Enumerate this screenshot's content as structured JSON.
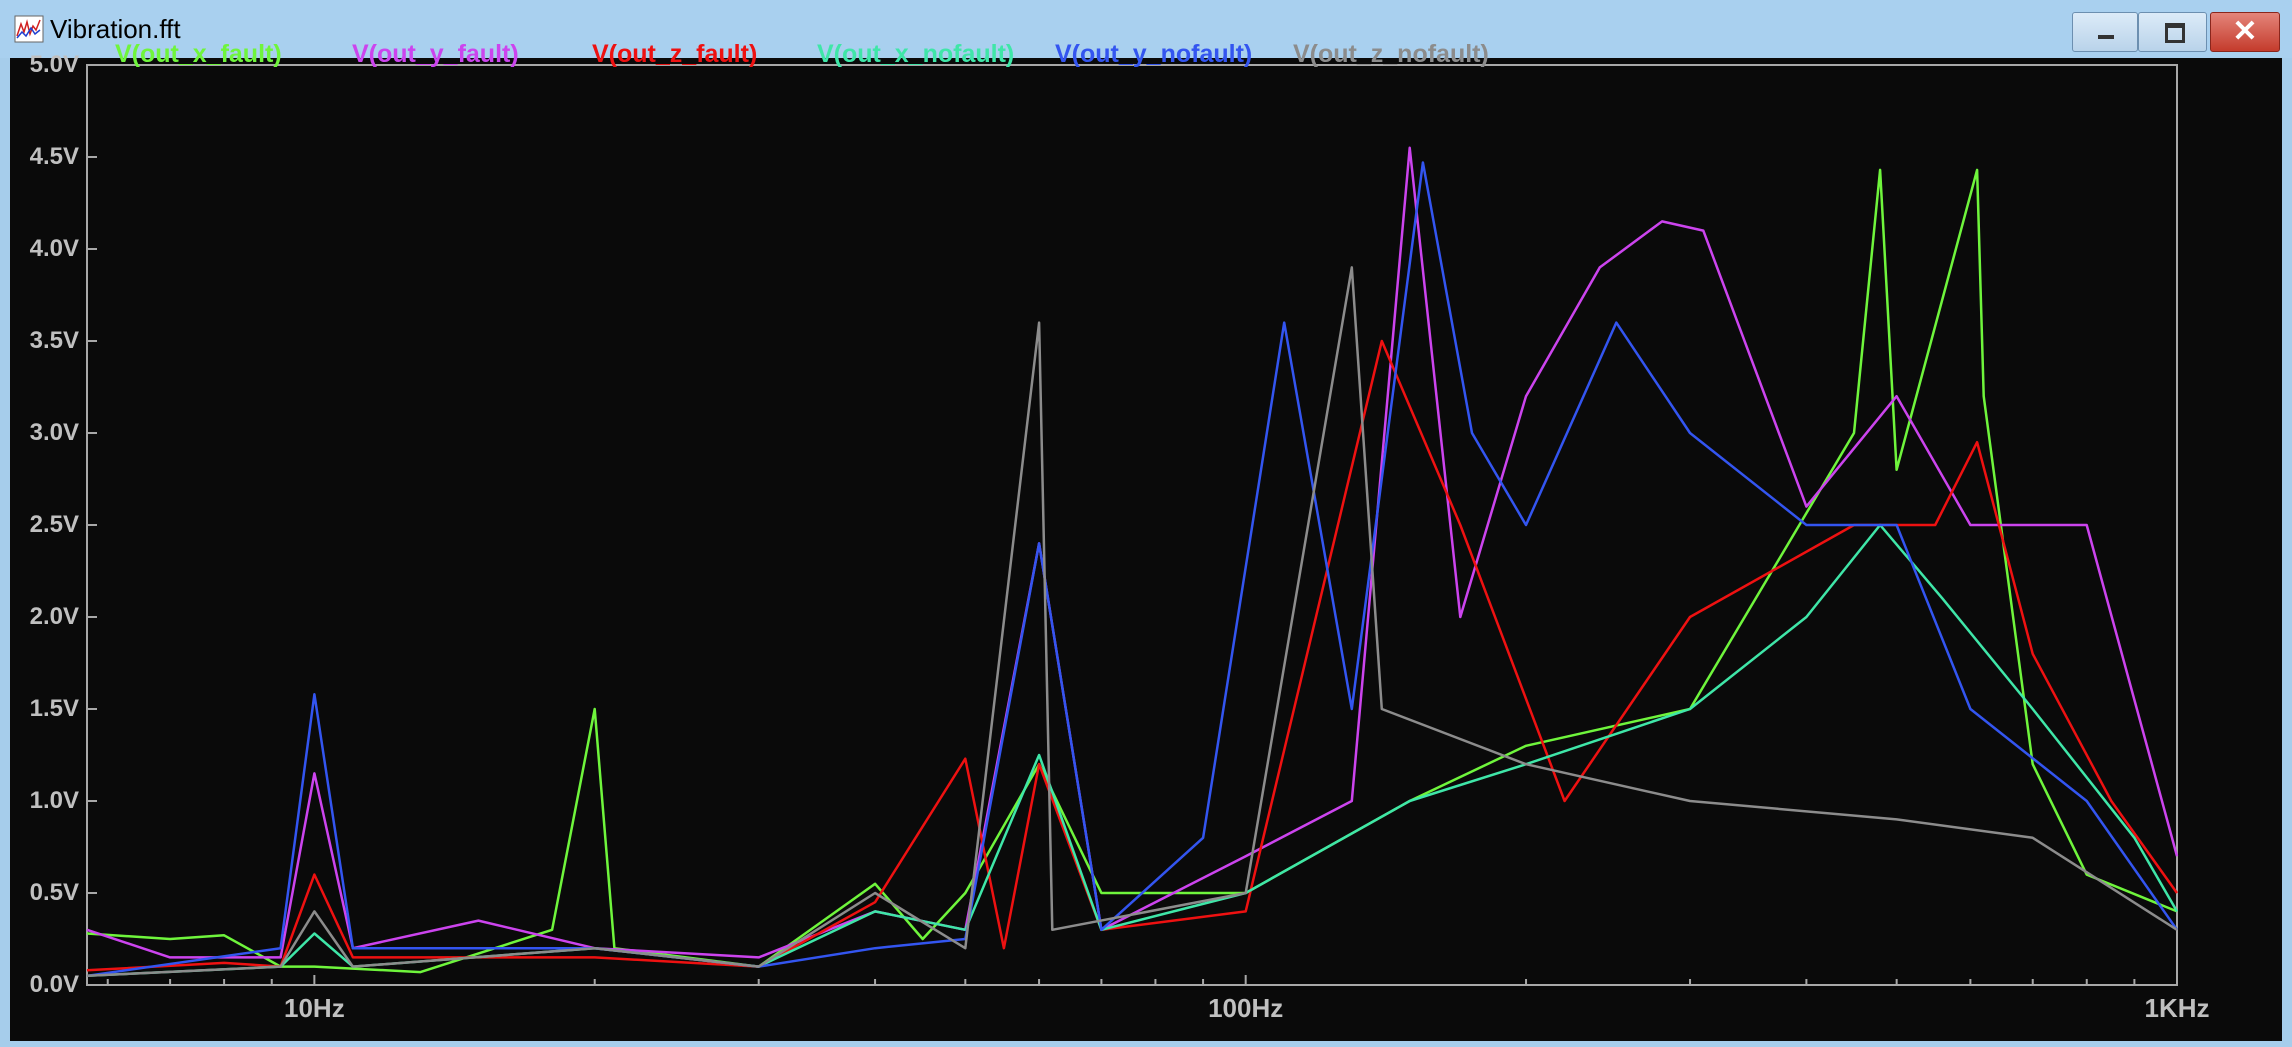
{
  "window": {
    "title": "Vibration.fft",
    "controls": {
      "minimize": "minimize-icon",
      "maximize": "maximize-icon",
      "close": "close-icon"
    }
  },
  "chart_data": {
    "type": "line",
    "title": "",
    "xlabel": "",
    "ylabel": "",
    "x_scale": "log",
    "xlim": [
      5.7,
      1000
    ],
    "ylim": [
      0,
      5.0
    ],
    "x_ticks": [
      {
        "value": 10,
        "label": "10Hz"
      },
      {
        "value": 100,
        "label": "100Hz"
      },
      {
        "value": 1000,
        "label": "1KHz"
      }
    ],
    "y_ticks": [
      {
        "value": 0.0,
        "label": "0.0V"
      },
      {
        "value": 0.5,
        "label": "0.5V"
      },
      {
        "value": 1.0,
        "label": "1.0V"
      },
      {
        "value": 1.5,
        "label": "1.5V"
      },
      {
        "value": 2.0,
        "label": "2.0V"
      },
      {
        "value": 2.5,
        "label": "2.5V"
      },
      {
        "value": 3.0,
        "label": "3.0V"
      },
      {
        "value": 3.5,
        "label": "3.5V"
      },
      {
        "value": 4.0,
        "label": "4.0V"
      },
      {
        "value": 4.5,
        "label": "4.5V"
      },
      {
        "value": 5.0,
        "label": "5.0V"
      }
    ],
    "legend": "top",
    "background": "#0a0a0a",
    "grid": false,
    "series": [
      {
        "name": "V(out_x_fault)",
        "color": "#6ff53c",
        "points": [
          [
            5.7,
            0.28
          ],
          [
            7,
            0.25
          ],
          [
            8,
            0.27
          ],
          [
            9.2,
            0.1
          ],
          [
            10,
            0.1
          ],
          [
            13,
            0.07
          ],
          [
            18,
            0.3
          ],
          [
            20,
            1.5
          ],
          [
            21,
            0.2
          ],
          [
            30,
            0.1
          ],
          [
            40,
            0.55
          ],
          [
            45,
            0.25
          ],
          [
            50,
            0.5
          ],
          [
            60,
            1.2
          ],
          [
            70,
            0.5
          ],
          [
            100,
            0.5
          ],
          [
            150,
            1.0
          ],
          [
            200,
            1.3
          ],
          [
            300,
            1.5
          ],
          [
            450,
            3.0
          ],
          [
            480,
            4.43
          ],
          [
            500,
            2.8
          ],
          [
            610,
            4.43
          ],
          [
            620,
            3.2
          ],
          [
            700,
            1.2
          ],
          [
            800,
            0.6
          ],
          [
            1000,
            0.4
          ]
        ]
      },
      {
        "name": "V(out_y_fault)",
        "color": "#cc44ee",
        "points": [
          [
            5.7,
            0.3
          ],
          [
            7,
            0.15
          ],
          [
            9.2,
            0.15
          ],
          [
            10,
            1.15
          ],
          [
            11,
            0.2
          ],
          [
            15,
            0.35
          ],
          [
            20,
            0.2
          ],
          [
            30,
            0.15
          ],
          [
            40,
            0.4
          ],
          [
            50,
            0.3
          ],
          [
            60,
            2.4
          ],
          [
            70,
            0.3
          ],
          [
            100,
            0.7
          ],
          [
            130,
            1.0
          ],
          [
            150,
            4.55
          ],
          [
            170,
            2.0
          ],
          [
            200,
            3.2
          ],
          [
            240,
            3.9
          ],
          [
            280,
            4.15
          ],
          [
            310,
            4.1
          ],
          [
            400,
            2.6
          ],
          [
            500,
            3.2
          ],
          [
            600,
            2.5
          ],
          [
            700,
            2.5
          ],
          [
            800,
            2.5
          ],
          [
            1000,
            0.7
          ]
        ]
      },
      {
        "name": "V(out_z_fault)",
        "color": "#ee1111",
        "points": [
          [
            5.7,
            0.08
          ],
          [
            8,
            0.12
          ],
          [
            9.2,
            0.1
          ],
          [
            10,
            0.6
          ],
          [
            11,
            0.15
          ],
          [
            20,
            0.15
          ],
          [
            30,
            0.1
          ],
          [
            40,
            0.45
          ],
          [
            50,
            1.23
          ],
          [
            55,
            0.2
          ],
          [
            60,
            1.2
          ],
          [
            70,
            0.3
          ],
          [
            100,
            0.4
          ],
          [
            140,
            3.5
          ],
          [
            170,
            2.5
          ],
          [
            220,
            1.0
          ],
          [
            300,
            2.0
          ],
          [
            450,
            2.5
          ],
          [
            550,
            2.5
          ],
          [
            610,
            2.95
          ],
          [
            700,
            1.8
          ],
          [
            850,
            1.0
          ],
          [
            1000,
            0.5
          ]
        ]
      },
      {
        "name": "V(out_x_nofault)",
        "color": "#3fe6a8",
        "points": [
          [
            5.7,
            0.05
          ],
          [
            9.2,
            0.1
          ],
          [
            10,
            0.28
          ],
          [
            11,
            0.1
          ],
          [
            20,
            0.2
          ],
          [
            30,
            0.1
          ],
          [
            40,
            0.4
          ],
          [
            50,
            0.3
          ],
          [
            60,
            1.25
          ],
          [
            70,
            0.3
          ],
          [
            100,
            0.5
          ],
          [
            150,
            1.0
          ],
          [
            200,
            1.2
          ],
          [
            300,
            1.5
          ],
          [
            400,
            2.0
          ],
          [
            480,
            2.5
          ],
          [
            560,
            2.1
          ],
          [
            700,
            1.5
          ],
          [
            900,
            0.8
          ],
          [
            1000,
            0.4
          ]
        ]
      },
      {
        "name": "V(out_y_nofault)",
        "color": "#3355f0",
        "points": [
          [
            5.7,
            0.05
          ],
          [
            9.2,
            0.2
          ],
          [
            10,
            1.58
          ],
          [
            11,
            0.2
          ],
          [
            20,
            0.2
          ],
          [
            30,
            0.1
          ],
          [
            40,
            0.2
          ],
          [
            50,
            0.25
          ],
          [
            60,
            2.4
          ],
          [
            70,
            0.3
          ],
          [
            90,
            0.8
          ],
          [
            110,
            3.6
          ],
          [
            130,
            1.5
          ],
          [
            155,
            4.47
          ],
          [
            175,
            3.0
          ],
          [
            200,
            2.5
          ],
          [
            250,
            3.6
          ],
          [
            300,
            3.0
          ],
          [
            400,
            2.5
          ],
          [
            500,
            2.5
          ],
          [
            600,
            1.5
          ],
          [
            800,
            1.0
          ],
          [
            1000,
            0.3
          ]
        ]
      },
      {
        "name": "V(out_z_nofault)",
        "color": "#8c8c8c",
        "points": [
          [
            5.7,
            0.05
          ],
          [
            9.2,
            0.1
          ],
          [
            10,
            0.4
          ],
          [
            11,
            0.1
          ],
          [
            20,
            0.2
          ],
          [
            30,
            0.1
          ],
          [
            40,
            0.5
          ],
          [
            50,
            0.2
          ],
          [
            60,
            3.6
          ],
          [
            62,
            0.3
          ],
          [
            100,
            0.5
          ],
          [
            130,
            3.9
          ],
          [
            140,
            1.5
          ],
          [
            200,
            1.2
          ],
          [
            300,
            1.0
          ],
          [
            500,
            0.9
          ],
          [
            700,
            0.8
          ],
          [
            1000,
            0.3
          ]
        ]
      }
    ]
  }
}
